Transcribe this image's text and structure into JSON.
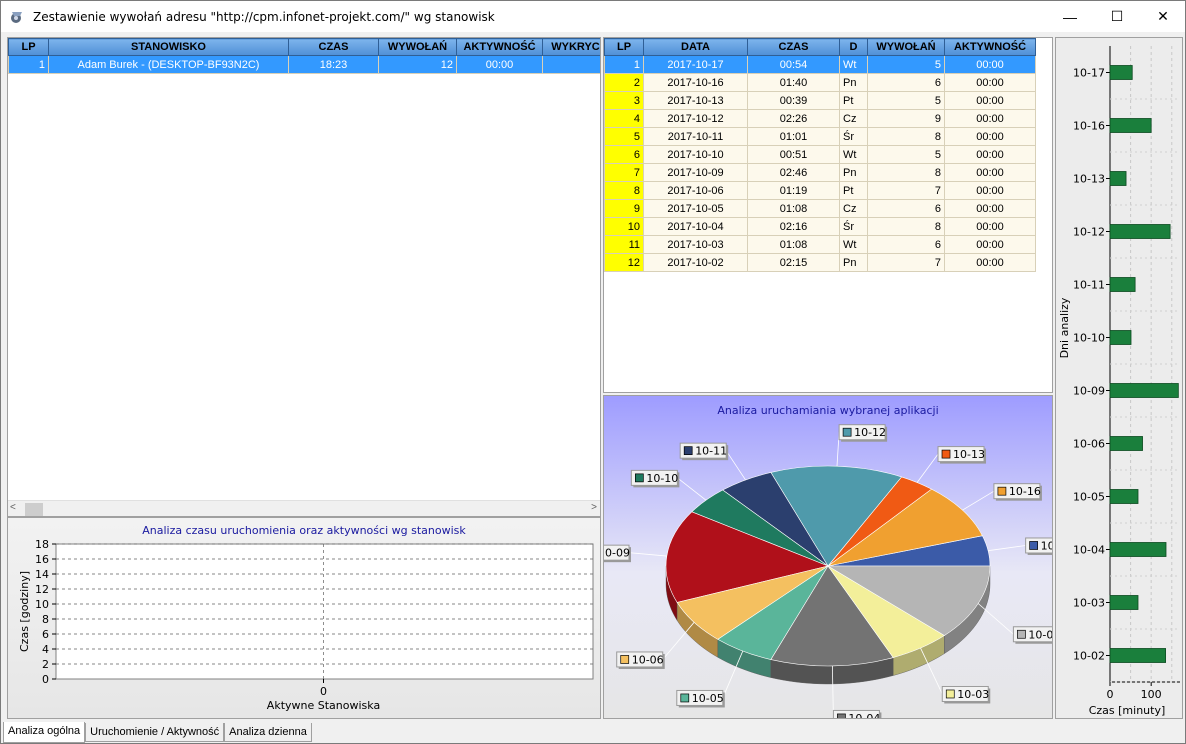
{
  "window": {
    "title": "Zestawienie wywołań adresu \"http://cpm.infonet-projekt.com/\" wg stanowisk",
    "minimize": "—",
    "maximize": "☐",
    "close": "✕"
  },
  "left_grid": {
    "columns": [
      "LP",
      "STANOWISKO",
      "CZAS",
      "WYWOŁAŃ",
      "AKTYWNOŚĆ",
      "WYKRYC"
    ],
    "rows": [
      {
        "lp": "1",
        "stanowisko": "Adam Burek - (DESKTOP-BF93N2C)",
        "czas": "18:23",
        "wywolan": "12",
        "aktywnosc": "00:00",
        "wykryc": ""
      }
    ]
  },
  "right_grid": {
    "columns": [
      "LP",
      "DATA",
      "CZAS",
      "D",
      "WYWOŁAŃ",
      "AKTYWNOŚĆ"
    ],
    "rows": [
      {
        "lp": "1",
        "data": "2017-10-17",
        "czas": "00:54",
        "d": "Wt",
        "wywolan": "5",
        "aktywnosc": "00:00"
      },
      {
        "lp": "2",
        "data": "2017-10-16",
        "czas": "01:40",
        "d": "Pn",
        "wywolan": "6",
        "aktywnosc": "00:00"
      },
      {
        "lp": "3",
        "data": "2017-10-13",
        "czas": "00:39",
        "d": "Pt",
        "wywolan": "5",
        "aktywnosc": "00:00"
      },
      {
        "lp": "4",
        "data": "2017-10-12",
        "czas": "02:26",
        "d": "Cz",
        "wywolan": "9",
        "aktywnosc": "00:00"
      },
      {
        "lp": "5",
        "data": "2017-10-11",
        "czas": "01:01",
        "d": "Śr",
        "wywolan": "8",
        "aktywnosc": "00:00"
      },
      {
        "lp": "6",
        "data": "2017-10-10",
        "czas": "00:51",
        "d": "Wt",
        "wywolan": "5",
        "aktywnosc": "00:00"
      },
      {
        "lp": "7",
        "data": "2017-10-09",
        "czas": "02:46",
        "d": "Pn",
        "wywolan": "8",
        "aktywnosc": "00:00"
      },
      {
        "lp": "8",
        "data": "2017-10-06",
        "czas": "01:19",
        "d": "Pt",
        "wywolan": "7",
        "aktywnosc": "00:00"
      },
      {
        "lp": "9",
        "data": "2017-10-05",
        "czas": "01:08",
        "d": "Cz",
        "wywolan": "6",
        "aktywnosc": "00:00"
      },
      {
        "lp": "10",
        "data": "2017-10-04",
        "czas": "02:16",
        "d": "Śr",
        "wywolan": "8",
        "aktywnosc": "00:00"
      },
      {
        "lp": "11",
        "data": "2017-10-03",
        "czas": "01:08",
        "d": "Wt",
        "wywolan": "6",
        "aktywnosc": "00:00"
      },
      {
        "lp": "12",
        "data": "2017-10-02",
        "czas": "02:15",
        "d": "Pn",
        "wywolan": "7",
        "aktywnosc": "00:00"
      }
    ]
  },
  "tabs": [
    "Analiza ogólna",
    "Uruchomienie / Aktywność",
    "Analiza dzienna"
  ],
  "chart_data": [
    {
      "type": "bar",
      "title": "Analiza czasu uruchomienia oraz aktywności wg stanowisk",
      "xlabel": "Aktywne Stanowiska",
      "ylabel": "Czas [godziny]",
      "categories": [
        "0"
      ],
      "yticks": [
        "0",
        "2",
        "4",
        "6",
        "8",
        "10",
        "12",
        "14",
        "16",
        "18"
      ],
      "ylim": [
        0,
        18
      ],
      "values": [],
      "grid": true
    },
    {
      "type": "pie",
      "title": "Analiza uruchamiania wybranej aplikacji",
      "categories": [
        "10-17",
        "10-16",
        "10-13",
        "10-12",
        "10-11",
        "10-10",
        "10-09",
        "10-06",
        "10-05",
        "10-04",
        "10-03",
        "10-02"
      ],
      "values": [
        54,
        100,
        39,
        146,
        61,
        51,
        166,
        79,
        68,
        136,
        68,
        135
      ],
      "colors": [
        "#3b5ba8",
        "#f0a030",
        "#f05a14",
        "#4f9aab",
        "#2b3f6e",
        "#1f7a5f",
        "#b0101a",
        "#f4c060",
        "#5ab59a",
        "#737373",
        "#f3ef9a",
        "#b5b5b5"
      ]
    },
    {
      "type": "bar",
      "orientation": "horizontal",
      "xlabel": "Czas [minuty]",
      "ylabel": "Dni analizy",
      "categories": [
        "10-17",
        "10-16",
        "10-13",
        "10-12",
        "10-11",
        "10-10",
        "10-09",
        "10-06",
        "10-05",
        "10-04",
        "10-03",
        "10-02"
      ],
      "values": [
        54,
        100,
        39,
        146,
        61,
        51,
        166,
        79,
        68,
        136,
        68,
        135
      ],
      "xticks": [
        "0",
        "100"
      ],
      "xlim": [
        0,
        170
      ],
      "grid": true,
      "color": "#1a7f3c"
    }
  ]
}
